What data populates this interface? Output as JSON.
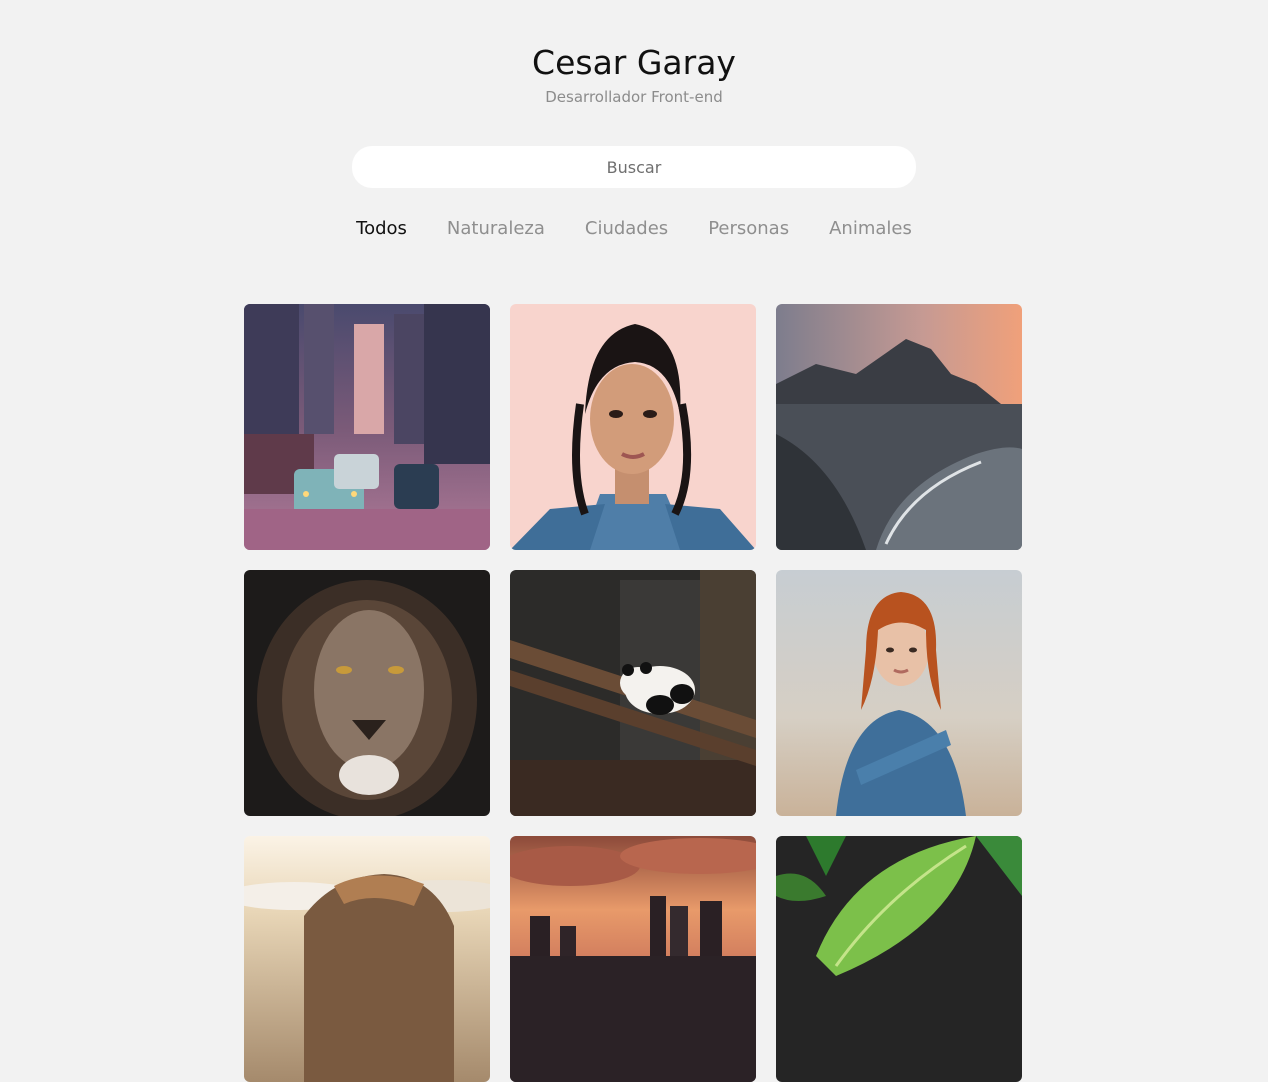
{
  "header": {
    "name": "Cesar Garay",
    "role": "Desarrollador Front-end"
  },
  "search": {
    "placeholder": "Buscar"
  },
  "filters": [
    {
      "label": "Todos",
      "active": true
    },
    {
      "label": "Naturaleza",
      "active": false
    },
    {
      "label": "Ciudades",
      "active": false
    },
    {
      "label": "Personas",
      "active": false
    },
    {
      "label": "Animales",
      "active": false
    }
  ],
  "gallery": [
    {
      "subject": "city-street-traffic",
      "category": "Ciudades"
    },
    {
      "subject": "woman-portrait-pink",
      "category": "Personas"
    },
    {
      "subject": "mountain-coast-sunset",
      "category": "Naturaleza"
    },
    {
      "subject": "lion-portrait",
      "category": "Animales"
    },
    {
      "subject": "panda-on-log",
      "category": "Animales"
    },
    {
      "subject": "redhead-woman-field",
      "category": "Personas"
    },
    {
      "subject": "rock-above-clouds",
      "category": "Naturaleza"
    },
    {
      "subject": "city-skyline-sunset",
      "category": "Ciudades"
    },
    {
      "subject": "green-leaf",
      "category": "Naturaleza"
    }
  ]
}
